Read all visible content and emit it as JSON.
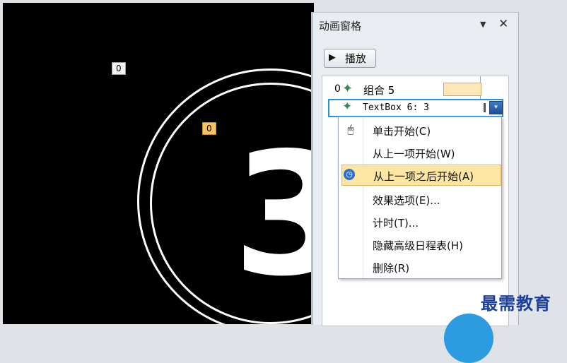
{
  "slide": {
    "tag_1": "0",
    "tag_2": "0",
    "big_digit": "3"
  },
  "animation_pane": {
    "title": "动画窗格",
    "dropdown_icon": "▼",
    "close_icon": "✕",
    "play_button": {
      "icon": "▶",
      "label": "播放"
    },
    "items": [
      {
        "number": "0",
        "icon": "star-icon",
        "label": "组合 5"
      },
      {
        "icon": "star-icon",
        "label": "TextBox 6: 3",
        "dropdown_icon": "▾"
      }
    ]
  },
  "context_menu": {
    "items": [
      {
        "label": "单击开始(C)",
        "icon": "mouse-icon"
      },
      {
        "label": "从上一项开始(W)"
      },
      {
        "label": "从上一项之后开始(A)",
        "icon": "clock-icon",
        "highlighted": true
      },
      {
        "label": "效果选项(E)..."
      },
      {
        "label": "计时(T)..."
      },
      {
        "label": "隐藏高级日程表(H)"
      },
      {
        "label": "删除(R)"
      }
    ]
  },
  "watermark": "最需教育"
}
